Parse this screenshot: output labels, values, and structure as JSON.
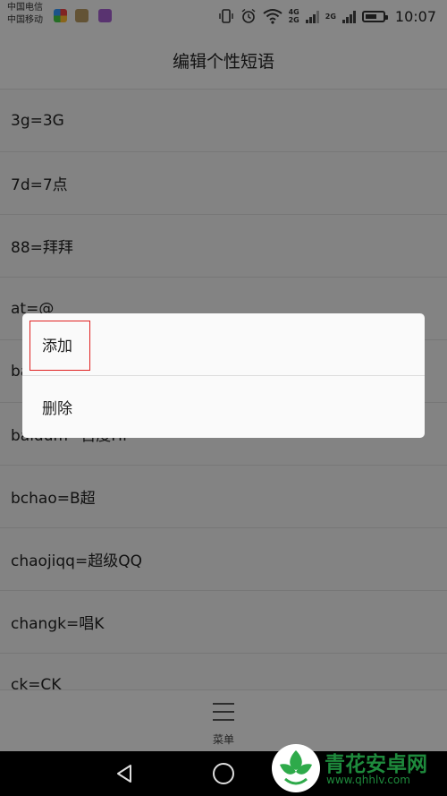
{
  "status_bar": {
    "carriers": [
      "中国电信",
      "中国移动"
    ],
    "network_4g": "4G",
    "network_2g_a": "2G",
    "network_2g_b": "2G",
    "time": "10:07",
    "icons": [
      "vibrate-icon",
      "alarm-icon",
      "wifi-icon",
      "signal-icon",
      "battery-icon"
    ]
  },
  "header": {
    "title": "编辑个性短语"
  },
  "phrases": [
    "3g=3G",
    "7d=7点",
    "88=拜拜",
    "at=@",
    "ba",
    "baidum=百度Hi",
    "bchao=B超",
    "chaojiqq=超级QQ",
    "changk=唱K",
    "ck=CK"
  ],
  "popup_menu": {
    "items": [
      "添加",
      "删除"
    ]
  },
  "bottom_menu": {
    "label": "菜单"
  },
  "watermark": {
    "name": "青花安卓网",
    "url": "www.qhhlv.com"
  },
  "colors": {
    "highlight": "#e02020",
    "watermark": "#1e8a3c"
  }
}
